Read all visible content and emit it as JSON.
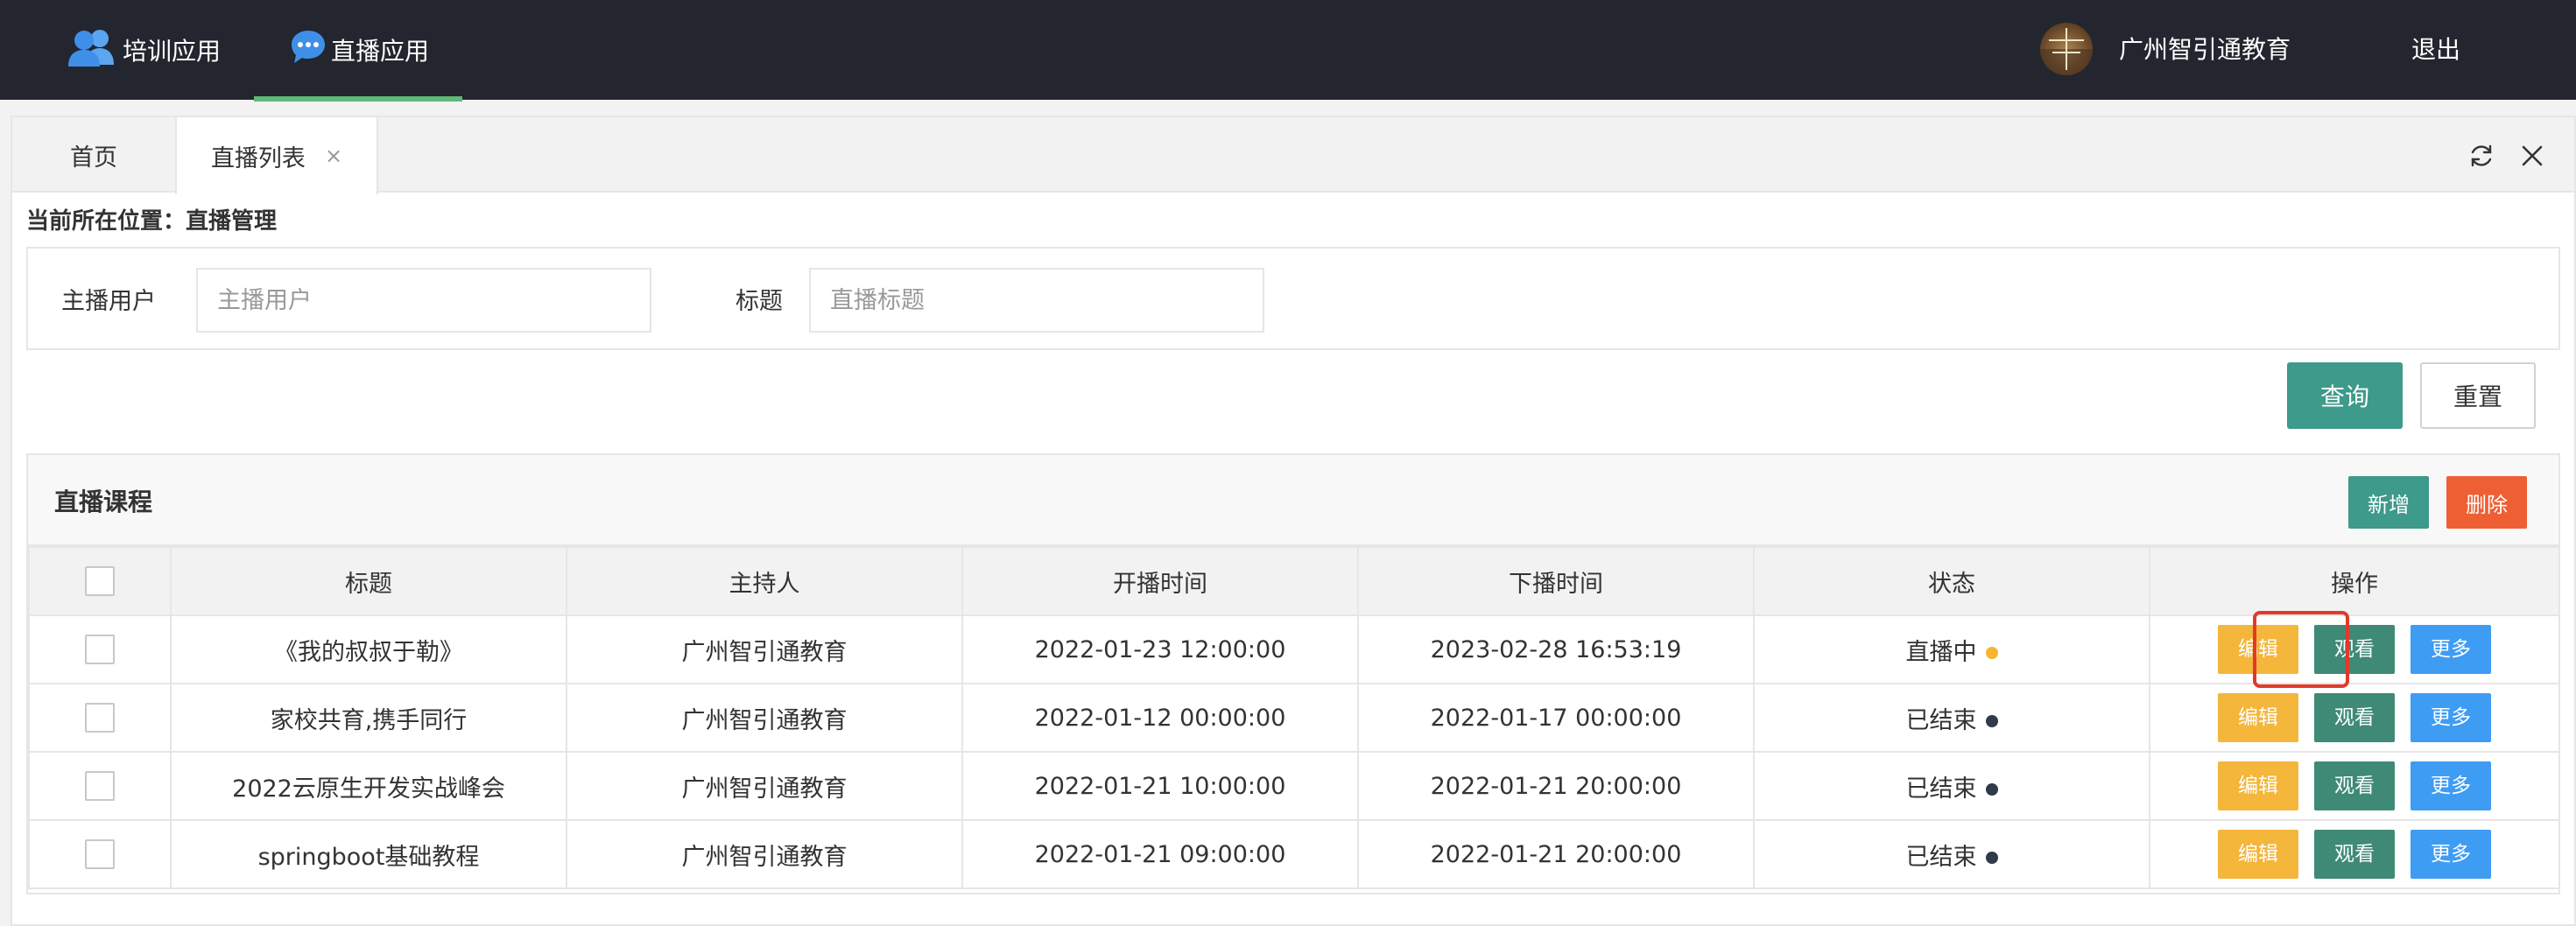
{
  "header": {
    "nav": [
      {
        "label": "培训应用",
        "icon": "users-icon"
      },
      {
        "label": "直播应用",
        "icon": "chat-bubble-icon",
        "active": true
      }
    ],
    "user_name": "广州智引通教育",
    "logout_label": "退出"
  },
  "tabs": {
    "home_label": "首页",
    "current_label": "直播列表",
    "close_glyph": "×"
  },
  "breadcrumb": "当前所在位置：直播管理",
  "search": {
    "host_label": "主播用户",
    "host_placeholder": "主播用户",
    "title_label": "标题",
    "title_placeholder": "直播标题",
    "query_label": "查询",
    "reset_label": "重置"
  },
  "table": {
    "title": "直播课程",
    "add_label": "新增",
    "delete_label": "删除",
    "columns": [
      "标题",
      "主持人",
      "开播时间",
      "下播时间",
      "状态",
      "操作"
    ],
    "rows": [
      {
        "title": "《我的叔叔于勒》",
        "host": "广州智引通教育",
        "start": "2022-01-23 12:00:00",
        "end": "2023-02-28 16:53:19",
        "status": "直播中",
        "status_color": "#f7b52d",
        "highlight_view": true
      },
      {
        "title": "家校共育,携手同行",
        "host": "广州智引通教育",
        "start": "2022-01-12 00:00:00",
        "end": "2022-01-17 00:00:00",
        "status": "已结束",
        "status_color": "#2f3a4a",
        "highlight_view": false
      },
      {
        "title": "2022云原生开发实战峰会",
        "host": "广州智引通教育",
        "start": "2022-01-21 10:00:00",
        "end": "2022-01-21 20:00:00",
        "status": "已结束",
        "status_color": "#2f3a4a",
        "highlight_view": false
      },
      {
        "title": "springboot基础教程",
        "host": "广州智引通教育",
        "start": "2022-01-21 09:00:00",
        "end": "2022-01-21 20:00:00",
        "status": "已结束",
        "status_color": "#2f3a4a",
        "highlight_view": false
      }
    ],
    "row_actions": {
      "edit": "编辑",
      "view": "观看",
      "more": "更多"
    }
  },
  "colors": {
    "header_bg": "#23262e",
    "active_underline": "#5fb878",
    "primary": "#3e9a8a",
    "danger": "#ee5f33",
    "warning": "#f4b63b",
    "info": "#3f9cf3",
    "highlight": "#e23a2a"
  }
}
